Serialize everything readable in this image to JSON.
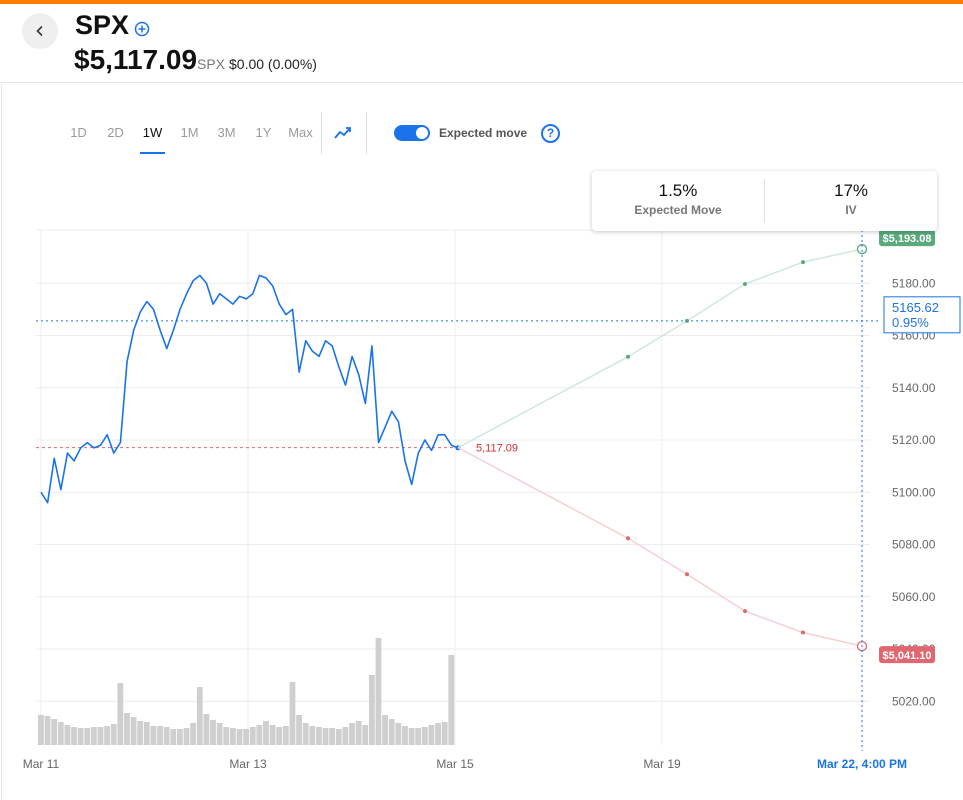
{
  "header": {
    "symbol": "SPX",
    "price": "$5,117.09",
    "sub_symbol": "SPX",
    "change": "$0.00 (0.00%)"
  },
  "toolbar": {
    "ranges": [
      "1D",
      "2D",
      "1W",
      "1M",
      "3M",
      "1Y",
      "Max"
    ],
    "active_range": "1W",
    "expected_move_label": "Expected move",
    "expected_move_enabled": true,
    "help_label": "?"
  },
  "stats": {
    "expected_move_value": "1.5%",
    "expected_move_label": "Expected Move",
    "iv_value": "17%",
    "iv_label": "IV"
  },
  "colors": {
    "accent": "#1a73e8",
    "price_line": "#1a73e8",
    "up": "#5aaa7e",
    "down": "#e06670",
    "brand_bar": "#ff7a00"
  },
  "chart_data": {
    "type": "line",
    "y_ticks": [
      5180,
      5160,
      5140,
      5120,
      5100,
      5080,
      5060,
      5040,
      5020
    ],
    "y_tick_labels": [
      "5180.00",
      "5160.00",
      "5140.00",
      "5120.00",
      "5100.00",
      "5080.00",
      "5060.00",
      "5040.00",
      "5020.00"
    ],
    "x_tick_labels": [
      "Mar 11",
      "Mar 13",
      "Mar 15",
      "Mar 19"
    ],
    "price_series": [
      5100,
      5096,
      5113,
      5101,
      5115,
      5112,
      5117,
      5119,
      5117,
      5118,
      5122,
      5115,
      5119,
      5150,
      5162,
      5169,
      5173,
      5170,
      5162,
      5155,
      5162,
      5170,
      5176,
      5181,
      5183,
      5180,
      5172,
      5176,
      5174,
      5172,
      5175,
      5174,
      5176,
      5183,
      5182,
      5179,
      5172,
      5168,
      5170,
      5146,
      5158,
      5154,
      5152,
      5158,
      5156,
      5148,
      5141,
      5152,
      5145,
      5134,
      5156,
      5119,
      5125,
      5131,
      5127,
      5112,
      5103,
      5115,
      5120,
      5116,
      5122,
      5122,
      5118,
      5117
    ],
    "volume_series": [
      30,
      29,
      26,
      23,
      20,
      18,
      17,
      17,
      18,
      18,
      19,
      21,
      62,
      32,
      28,
      24,
      23,
      19,
      19,
      18,
      16,
      16,
      17,
      22,
      58,
      31,
      25,
      22,
      18,
      17,
      16,
      16,
      18,
      20,
      24,
      20,
      18,
      19,
      63,
      30,
      22,
      19,
      18,
      17,
      17,
      16,
      18,
      22,
      24,
      20,
      70,
      107,
      30,
      26,
      22,
      19,
      17,
      17,
      18,
      20,
      22,
      23,
      90
    ],
    "current_price": 5117.09,
    "current_price_label": "5,117.09",
    "upper_band": [
      5117.09,
      5151.85,
      5165.6,
      5179.7,
      5188.1,
      5193.08
    ],
    "lower_band": [
      5117.09,
      5082.4,
      5068.6,
      5054.5,
      5046.3,
      5041.1
    ],
    "upper_target_label": "$5,193.08",
    "lower_target_label": "$5,041.10",
    "hover_price_label": "5165.62",
    "hover_pct_label": "0.95%",
    "hover_date_label": "Mar 22, 4:00 PM"
  }
}
